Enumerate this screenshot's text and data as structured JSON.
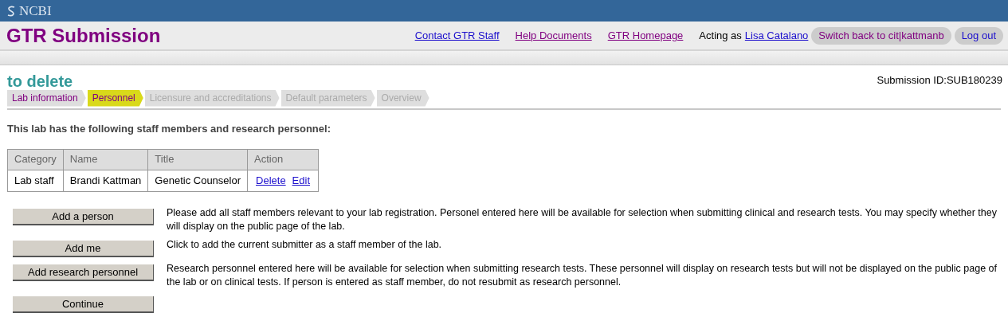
{
  "brand": "NCBI",
  "app_title": "GTR Submission",
  "header_links": [
    {
      "label": "Contact GTR Staff",
      "visited": false
    },
    {
      "label": "Help Documents",
      "visited": true
    },
    {
      "label": "GTR Homepage",
      "visited": true
    }
  ],
  "acting_as": {
    "label": "Acting as",
    "user": "Lisa Catalano"
  },
  "header_buttons": [
    {
      "label": "Switch back to cit|kattmanb",
      "visited": true
    },
    {
      "label": "Log out",
      "visited": false
    }
  ],
  "submission_title": "to delete",
  "submission_id": "Submission ID:SUB180239",
  "steps": [
    {
      "label": "Lab information",
      "selected": false,
      "disabled": false
    },
    {
      "label": "Personnel",
      "selected": true,
      "disabled": false
    },
    {
      "label": "Licensure and accreditations",
      "selected": false,
      "disabled": true
    },
    {
      "label": "Default parameters",
      "selected": false,
      "disabled": true
    },
    {
      "label": "Overview",
      "selected": false,
      "disabled": true
    }
  ],
  "intro": "This lab has the following staff members and research personnel:",
  "table": {
    "columns": [
      "Category",
      "Name",
      "Title",
      "Action"
    ],
    "rows": [
      {
        "cells": [
          "Lab staff",
          "Brandi Kattman",
          "Genetic Counselor"
        ],
        "actions": [
          "Delete",
          "Edit"
        ]
      }
    ]
  },
  "actions": [
    {
      "button": "Add a person",
      "description": "Please add all staff members relevant to your lab registration. Personel entered here will be available for selection when submitting clinical and research tests. You may specify whether they will display on the public page of the lab."
    },
    {
      "button": "Add me",
      "description": "Click to add the current submitter as a staff member of the lab."
    },
    {
      "button": "Add research personnel",
      "description": "Research personnel entered here will be available for selection when submitting research tests. These personnel will display on research tests but will not be displayed on the public page of the lab or on clinical tests. If person is entered as staff member, do not resubmit as research personnel."
    },
    {
      "button": "Continue"
    }
  ]
}
